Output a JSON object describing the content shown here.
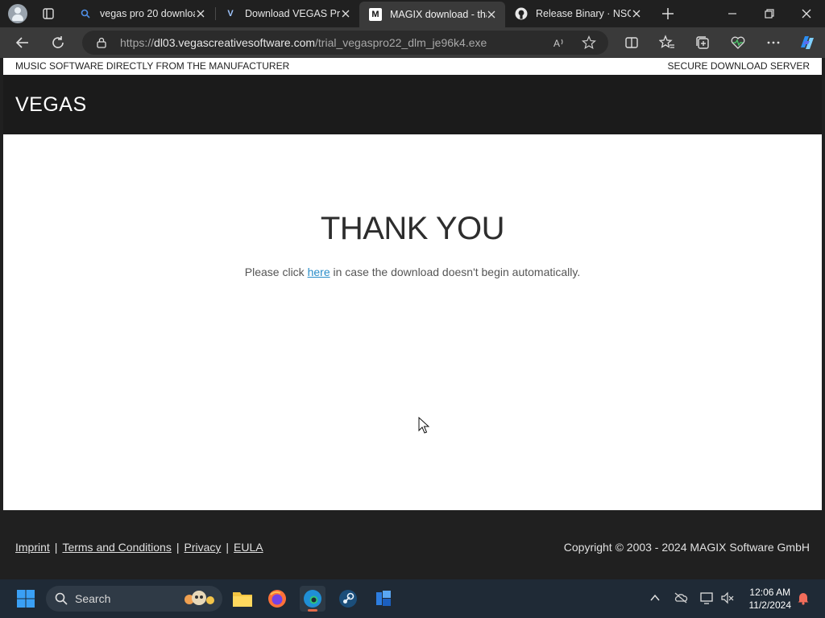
{
  "browser": {
    "tabs": [
      {
        "title": "vegas pro 20 downloa",
        "icon": "search-favicon",
        "active": false
      },
      {
        "title": "Download VEGAS Pro",
        "icon": "vegas-favicon",
        "active": false
      },
      {
        "title": "MAGIX download - tha",
        "icon": "magix-favicon",
        "active": true
      },
      {
        "title": "Release Binary · NSG6",
        "icon": "github-favicon",
        "active": false
      }
    ],
    "url_prefix": "https://",
    "url_host": "dl03.vegascreativesoftware.com",
    "url_path": "/trial_vegaspro22_dlm_je96k4.exe"
  },
  "page": {
    "top_left": "MUSIC SOFTWARE DIRECTLY FROM THE MANUFACTURER",
    "top_right": "SECURE DOWNLOAD SERVER",
    "logo": "VEGAS",
    "heading": "THANK YOU",
    "message_before": "Please click ",
    "message_link": "here",
    "message_after": " in case the download doesn't begin automatically.",
    "footer_links": [
      "Imprint",
      "Terms and Conditions",
      "Privacy",
      "EULA"
    ],
    "copyright": "Copyright © 2003 - 2024 MAGIX Software GmbH"
  },
  "taskbar": {
    "search_label": "Search",
    "time": "12:06 AM",
    "date": "11/2/2024"
  },
  "colors": {
    "accent_link": "#2a8dc8",
    "header_bg": "#1b1b1b",
    "footer_bg": "#202020"
  }
}
